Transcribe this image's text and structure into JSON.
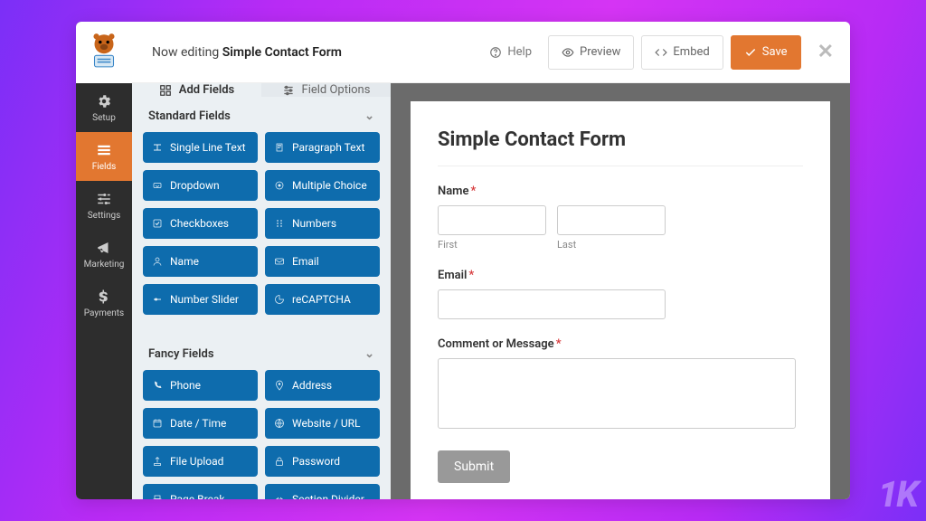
{
  "top": {
    "editing_prefix": "Now editing",
    "form_name": "Simple Contact Form",
    "help": "Help",
    "preview": "Preview",
    "embed": "Embed",
    "save": "Save"
  },
  "rail": {
    "setup": "Setup",
    "fields": "Fields",
    "settings": "Settings",
    "marketing": "Marketing",
    "payments": "Payments"
  },
  "panel": {
    "tab_add": "Add Fields",
    "tab_options": "Field Options",
    "section_standard": "Standard Fields",
    "section_fancy": "Fancy Fields",
    "standard": [
      "Single Line Text",
      "Paragraph Text",
      "Dropdown",
      "Multiple Choice",
      "Checkboxes",
      "Numbers",
      "Name",
      "Email",
      "Number Slider",
      "reCAPTCHA"
    ],
    "fancy": [
      "Phone",
      "Address",
      "Date / Time",
      "Website / URL",
      "File Upload",
      "Password",
      "Page Break",
      "Section Divider"
    ]
  },
  "form": {
    "title": "Simple Contact Form",
    "name_label": "Name",
    "first": "First",
    "last": "Last",
    "email_label": "Email",
    "comment_label": "Comment or Message",
    "submit": "Submit"
  }
}
